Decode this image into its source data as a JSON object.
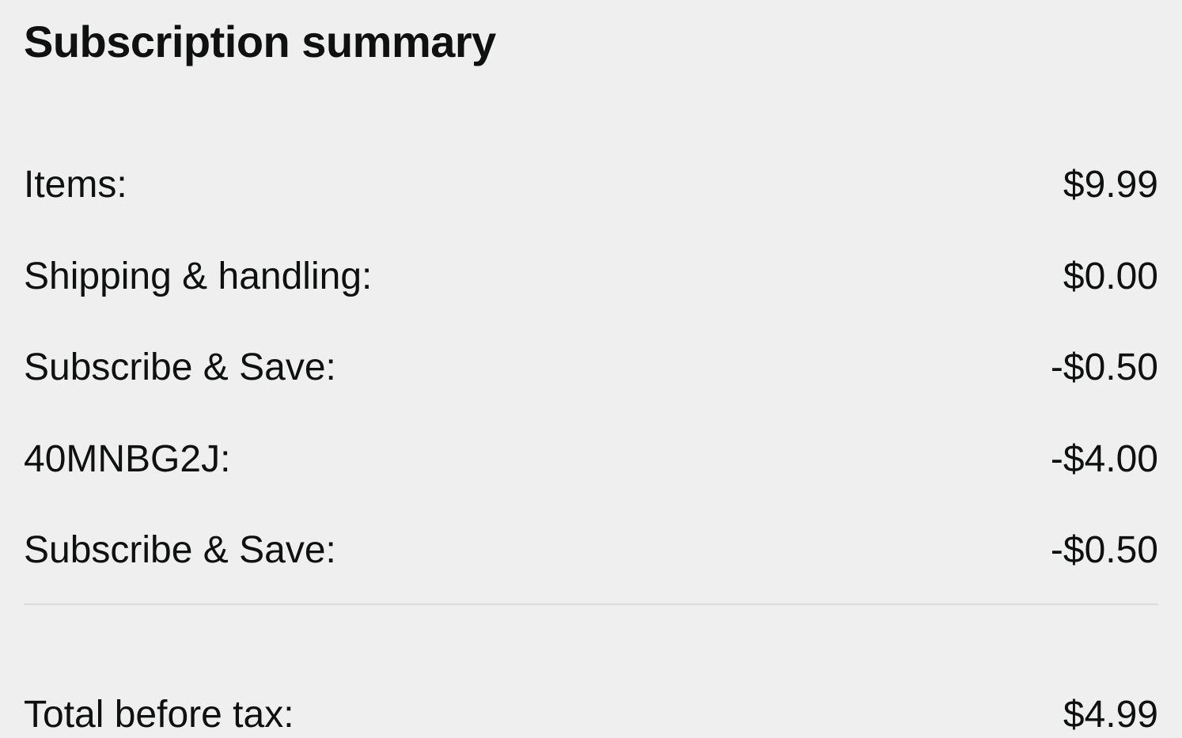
{
  "summary": {
    "title": "Subscription summary",
    "lines": [
      {
        "label": "Items:",
        "value": "$9.99"
      },
      {
        "label": "Shipping & handling:",
        "value": "$0.00"
      },
      {
        "label": "Subscribe & Save:",
        "value": "-$0.50"
      },
      {
        "label": "40MNBG2J:",
        "value": "-$4.00"
      },
      {
        "label": "Subscribe & Save:",
        "value": "-$0.50"
      }
    ],
    "total": {
      "label": "Total before tax:",
      "value": "$4.99"
    }
  }
}
